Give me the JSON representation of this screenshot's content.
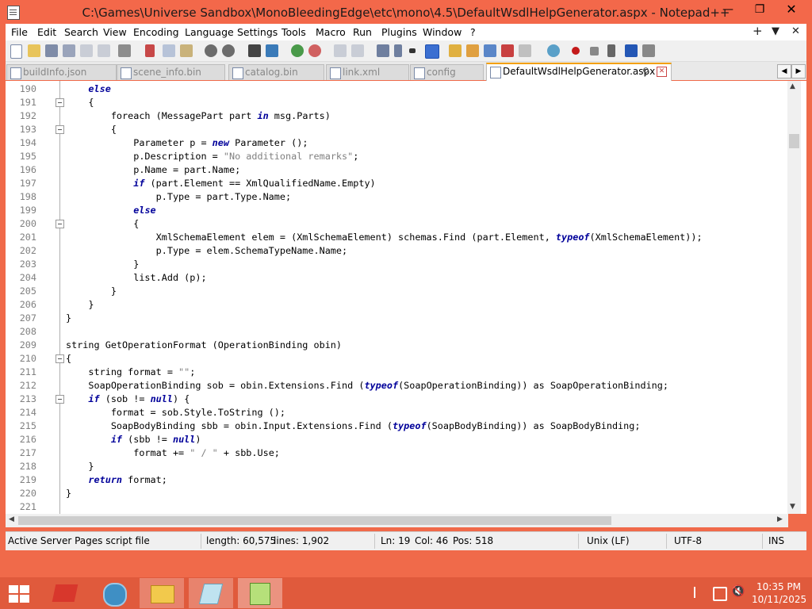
{
  "window": {
    "title": "C:\\Games\\Universe Sandbox\\MonoBleedingEdge\\etc\\mono\\4.5\\DefaultWsdlHelpGenerator.aspx - Notepad++",
    "minimize": "—",
    "maximize": "❐",
    "close": "✕"
  },
  "menu": {
    "items": [
      "File",
      "Edit",
      "Search",
      "View",
      "Encoding",
      "Language",
      "Settings",
      "Tools",
      "Macro",
      "Run",
      "Plugins",
      "Window",
      "?"
    ],
    "right_plus": "+",
    "right_down": "▼",
    "right_close": "✕"
  },
  "tabs": [
    {
      "label": "buildInfo.json"
    },
    {
      "label": "scene_info.bin"
    },
    {
      "label": "catalog.bin"
    },
    {
      "label": "link.xml"
    },
    {
      "label": "config"
    },
    {
      "label": "DefaultWsdlHelpGenerator.aspx",
      "active": true
    }
  ],
  "code_lines": [
    {
      "n": "190",
      "fold": false,
      "segs": [
        {
          "t": "    "
        },
        {
          "t": "else",
          "k": "kw"
        }
      ]
    },
    {
      "n": "191",
      "fold": true,
      "segs": [
        {
          "t": "    {"
        }
      ]
    },
    {
      "n": "192",
      "fold": false,
      "segs": [
        {
          "t": "        foreach (MessagePart part "
        },
        {
          "t": "in",
          "k": "kw"
        },
        {
          "t": " msg.Parts)"
        }
      ]
    },
    {
      "n": "193",
      "fold": true,
      "segs": [
        {
          "t": "        {"
        }
      ]
    },
    {
      "n": "194",
      "fold": false,
      "segs": [
        {
          "t": "            Parameter p = "
        },
        {
          "t": "new",
          "k": "kw"
        },
        {
          "t": " Parameter ();"
        }
      ]
    },
    {
      "n": "195",
      "fold": false,
      "segs": [
        {
          "t": "            p.Description = "
        },
        {
          "t": "\"No additional remarks\"",
          "k": "str"
        },
        {
          "t": ";"
        }
      ]
    },
    {
      "n": "196",
      "fold": false,
      "segs": [
        {
          "t": "            p.Name = part.Name;"
        }
      ]
    },
    {
      "n": "197",
      "fold": false,
      "segs": [
        {
          "t": "            "
        },
        {
          "t": "if",
          "k": "kw"
        },
        {
          "t": " (part.Element == XmlQualifiedName.Empty)"
        }
      ]
    },
    {
      "n": "198",
      "fold": false,
      "segs": [
        {
          "t": "                p.Type = part.Type.Name;"
        }
      ]
    },
    {
      "n": "199",
      "fold": false,
      "segs": [
        {
          "t": "            "
        },
        {
          "t": "else",
          "k": "kw"
        }
      ]
    },
    {
      "n": "200",
      "fold": true,
      "segs": [
        {
          "t": "            {"
        }
      ]
    },
    {
      "n": "201",
      "fold": false,
      "segs": [
        {
          "t": "                XmlSchemaElement elem = (XmlSchemaElement) schemas.Find (part.Element, "
        },
        {
          "t": "typeof",
          "k": "kw"
        },
        {
          "t": "(XmlSchemaElement));"
        }
      ]
    },
    {
      "n": "202",
      "fold": false,
      "segs": [
        {
          "t": "                p.Type = elem.SchemaTypeName.Name;"
        }
      ]
    },
    {
      "n": "203",
      "fold": false,
      "segs": [
        {
          "t": "            }"
        }
      ]
    },
    {
      "n": "204",
      "fold": false,
      "segs": [
        {
          "t": "            list.Add (p);"
        }
      ]
    },
    {
      "n": "205",
      "fold": false,
      "segs": [
        {
          "t": "        }"
        }
      ]
    },
    {
      "n": "206",
      "fold": false,
      "segs": [
        {
          "t": "    }"
        }
      ]
    },
    {
      "n": "207",
      "fold": false,
      "segs": [
        {
          "t": "}"
        }
      ]
    },
    {
      "n": "208",
      "fold": false,
      "segs": [
        {
          "t": ""
        }
      ]
    },
    {
      "n": "209",
      "fold": false,
      "segs": [
        {
          "t": "string GetOperationFormat (OperationBinding obin)"
        }
      ]
    },
    {
      "n": "210",
      "fold": true,
      "segs": [
        {
          "t": "{"
        }
      ]
    },
    {
      "n": "211",
      "fold": false,
      "segs": [
        {
          "t": "    string format = "
        },
        {
          "t": "\"\"",
          "k": "str"
        },
        {
          "t": ";"
        }
      ]
    },
    {
      "n": "212",
      "fold": false,
      "segs": [
        {
          "t": "    SoapOperationBinding sob = obin.Extensions.Find ("
        },
        {
          "t": "typeof",
          "k": "kw"
        },
        {
          "t": "(SoapOperationBinding)) as SoapOperationBinding;"
        }
      ]
    },
    {
      "n": "213",
      "fold": true,
      "segs": [
        {
          "t": "    "
        },
        {
          "t": "if",
          "k": "kw"
        },
        {
          "t": " (sob != "
        },
        {
          "t": "null",
          "k": "kw"
        },
        {
          "t": ") {"
        }
      ]
    },
    {
      "n": "214",
      "fold": false,
      "segs": [
        {
          "t": "        format = sob.Style.ToString ();"
        }
      ]
    },
    {
      "n": "215",
      "fold": false,
      "segs": [
        {
          "t": "        SoapBodyBinding sbb = obin.Input.Extensions.Find ("
        },
        {
          "t": "typeof",
          "k": "kw"
        },
        {
          "t": "(SoapBodyBinding)) as SoapBodyBinding;"
        }
      ]
    },
    {
      "n": "216",
      "fold": false,
      "segs": [
        {
          "t": "        "
        },
        {
          "t": "if",
          "k": "kw"
        },
        {
          "t": " (sbb != "
        },
        {
          "t": "null",
          "k": "kw"
        },
        {
          "t": ")"
        }
      ]
    },
    {
      "n": "217",
      "fold": false,
      "segs": [
        {
          "t": "            format += "
        },
        {
          "t": "\" / \"",
          "k": "str"
        },
        {
          "t": " + sbb.Use;"
        }
      ]
    },
    {
      "n": "218",
      "fold": false,
      "segs": [
        {
          "t": "    }"
        }
      ]
    },
    {
      "n": "219",
      "fold": false,
      "segs": [
        {
          "t": "    "
        },
        {
          "t": "return",
          "k": "kw"
        },
        {
          "t": " format;"
        }
      ]
    },
    {
      "n": "220",
      "fold": false,
      "segs": [
        {
          "t": "}"
        }
      ]
    },
    {
      "n": "221",
      "fold": false,
      "segs": [
        {
          "t": ""
        }
      ]
    }
  ],
  "status": {
    "filetype": "Active Server Pages script file",
    "length": "length: 60,575",
    "lines": "lines: 1,902",
    "ln": "Ln: 19",
    "col": "Col: 46",
    "pos": "Pos: 518",
    "eol": "Unix (LF)",
    "encoding": "UTF-8",
    "mode": "INS"
  },
  "clock": {
    "time": "10:35 PM",
    "date": "10/11/2025"
  },
  "colors": {
    "accent": "#f3684a",
    "taskbar": "#e05a3c",
    "keyword": "#00009a",
    "string": "#808080"
  }
}
